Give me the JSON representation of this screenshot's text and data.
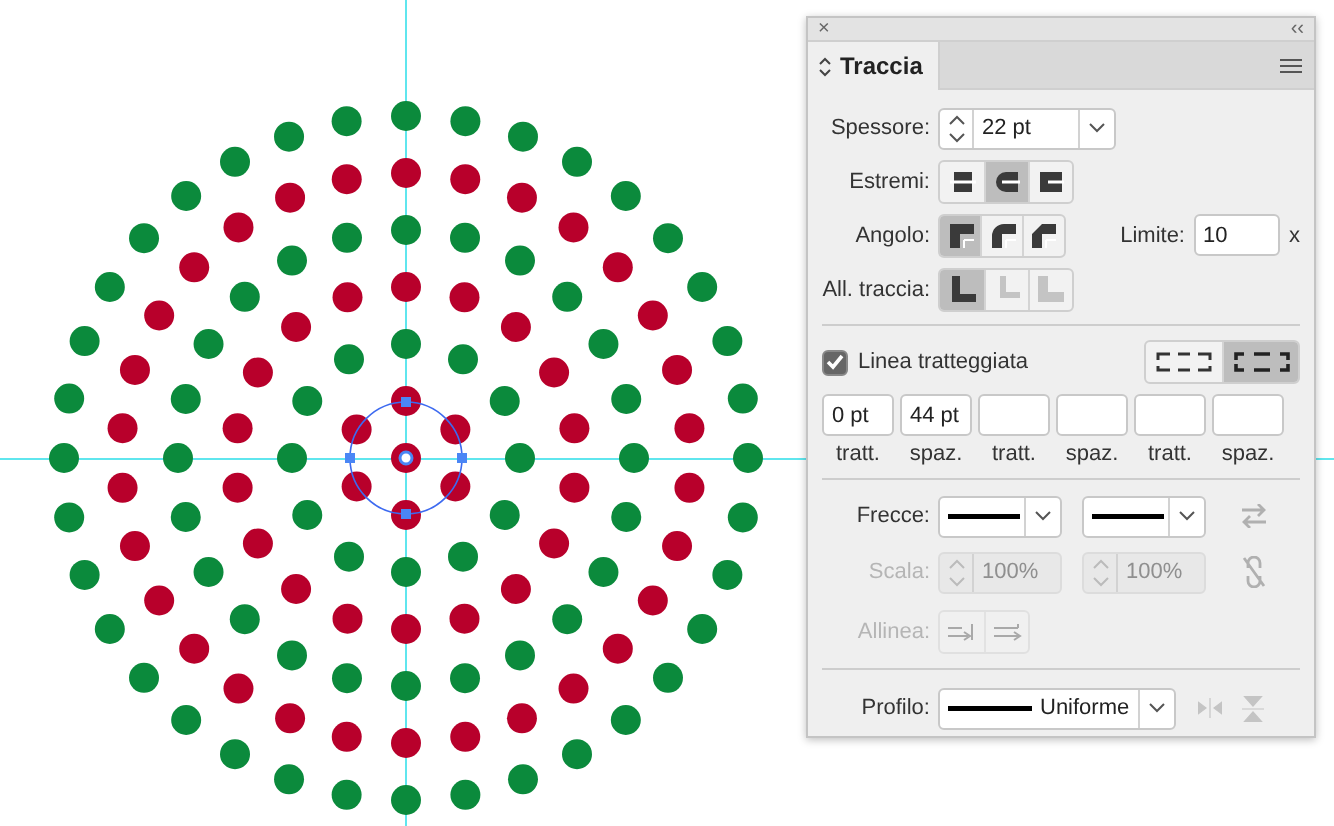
{
  "canvas": {
    "rings": [
      {
        "color": "#b8002b"
      },
      {
        "color": "#0b8a3c"
      },
      {
        "color": "#b8002b"
      },
      {
        "color": "#0b8a3c"
      },
      {
        "color": "#b8002b"
      },
      {
        "color": "#0b8a3c"
      }
    ]
  },
  "panel": {
    "close": "×",
    "collapse": "‹‹",
    "tab": {
      "label": "Traccia"
    },
    "weight": {
      "label": "Spessore:",
      "value": "22 pt"
    },
    "caps": {
      "label": "Estremi:",
      "options": [
        {
          "kind": "butt",
          "selected": false
        },
        {
          "kind": "round",
          "selected": true
        },
        {
          "kind": "square",
          "selected": false
        }
      ]
    },
    "corner": {
      "label": "Angolo:",
      "options": [
        {
          "kind": "miter",
          "selected": true
        },
        {
          "kind": "round",
          "selected": false
        },
        {
          "kind": "bevel",
          "selected": false
        }
      ]
    },
    "limit": {
      "label": "Limite:",
      "value": "10",
      "unit": "x"
    },
    "align": {
      "label": "All. traccia:",
      "options": [
        {
          "kind": "center",
          "selected": true,
          "disabled": false
        },
        {
          "kind": "inside",
          "selected": false,
          "disabled": true
        },
        {
          "kind": "outside",
          "selected": false,
          "disabled": true
        }
      ]
    },
    "dashed": {
      "label": "Linea tratteggiata",
      "checked": true,
      "modes": [
        {
          "kind": "exact",
          "selected": false
        },
        {
          "kind": "corners",
          "selected": true
        }
      ],
      "fields": [
        {
          "value": "0 pt",
          "caption": "tratt."
        },
        {
          "value": "44 pt",
          "caption": "spaz."
        },
        {
          "caption": "tratt."
        },
        {
          "caption": "spaz."
        },
        {
          "caption": "tratt."
        },
        {
          "caption": "spaz."
        }
      ]
    },
    "arrows": {
      "label": "Frecce:"
    },
    "scale": {
      "label": "Scala:",
      "disabled": true,
      "values": [
        "100%",
        "100%"
      ]
    },
    "arrow_align": {
      "label": "Allinea:",
      "disabled": true
    },
    "profile": {
      "label": "Profilo:",
      "value": "Uniforme"
    }
  }
}
